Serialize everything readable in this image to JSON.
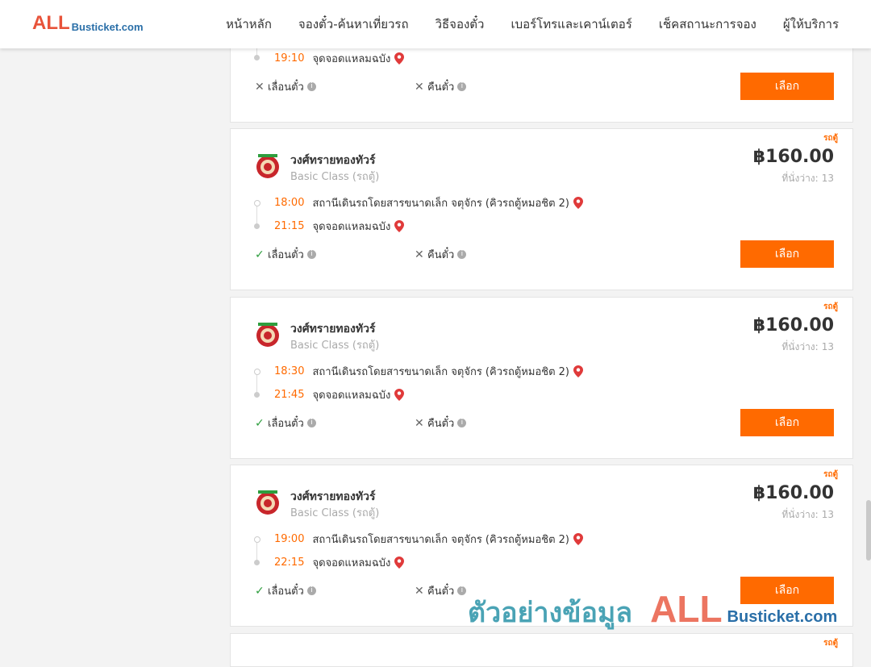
{
  "header": {
    "logo_big": "ALL",
    "logo_small": "Busticket.com",
    "nav": [
      "หน้าหลัก",
      "จองตั๋ว-ค้นหาเที่ยวรถ",
      "วิธีจองตั๋ว",
      "เบอร์โทรและเคาน์เตอร์",
      "เช็คสถานะการจอง",
      "ผู้ให้บริการ"
    ]
  },
  "partial_card": {
    "arrival_time": "19:10",
    "arrival_place": "จุดจอดแหลมฉบัง",
    "reschedule_label": "เลื่อนตั๋ว",
    "refund_label": "คืนตั๋ว",
    "select_label": "เลือก"
  },
  "cards": [
    {
      "tag": "รถตู้",
      "operator": "วงศ์ทรายทองทัวร์",
      "class": "Basic Class (รถตู้)",
      "price": "฿160.00",
      "seats_label": "ที่นั่งว่าง:",
      "seats": "13",
      "depart_time": "18:00",
      "depart_place": "สถานีเดินรถโดยสารขนาดเล็ก จตุจักร (คิวรถตู้หมอชิต 2)",
      "arrive_time": "21:15",
      "arrive_place": "จุดจอดแหลมฉบัง",
      "reschedule_label": "เลื่อนตั๋ว",
      "refund_label": "คืนตั๋ว",
      "select_label": "เลือก"
    },
    {
      "tag": "รถตู้",
      "operator": "วงศ์ทรายทองทัวร์",
      "class": "Basic Class (รถตู้)",
      "price": "฿160.00",
      "seats_label": "ที่นั่งว่าง:",
      "seats": "13",
      "depart_time": "18:30",
      "depart_place": "สถานีเดินรถโดยสารขนาดเล็ก จตุจักร (คิวรถตู้หมอชิต 2)",
      "arrive_time": "21:45",
      "arrive_place": "จุดจอดแหลมฉบัง",
      "reschedule_label": "เลื่อนตั๋ว",
      "refund_label": "คืนตั๋ว",
      "select_label": "เลือก"
    },
    {
      "tag": "รถตู้",
      "operator": "วงศ์ทรายทองทัวร์",
      "class": "Basic Class (รถตู้)",
      "price": "฿160.00",
      "seats_label": "ที่นั่งว่าง:",
      "seats": "13",
      "depart_time": "19:00",
      "depart_place": "สถานีเดินรถโดยสารขนาดเล็ก จตุจักร (คิวรถตู้หมอชิต 2)",
      "arrive_time": "22:15",
      "arrive_place": "จุดจอดแหลมฉบัง",
      "reschedule_label": "เลื่อนตั๋ว",
      "refund_label": "คืนตั๋ว",
      "select_label": "เลือก"
    }
  ],
  "bottom_card": {
    "tag": "รถตู้"
  },
  "watermark": {
    "text": "ตัวอย่างข้อมูล",
    "brand_big": "ALL",
    "brand_small": "Busticket.com"
  },
  "colors": {
    "accent": "#ff6a00",
    "logo_red": "#e8533a",
    "logo_blue": "#2a6fa8",
    "check_green": "#2e9e3e"
  }
}
